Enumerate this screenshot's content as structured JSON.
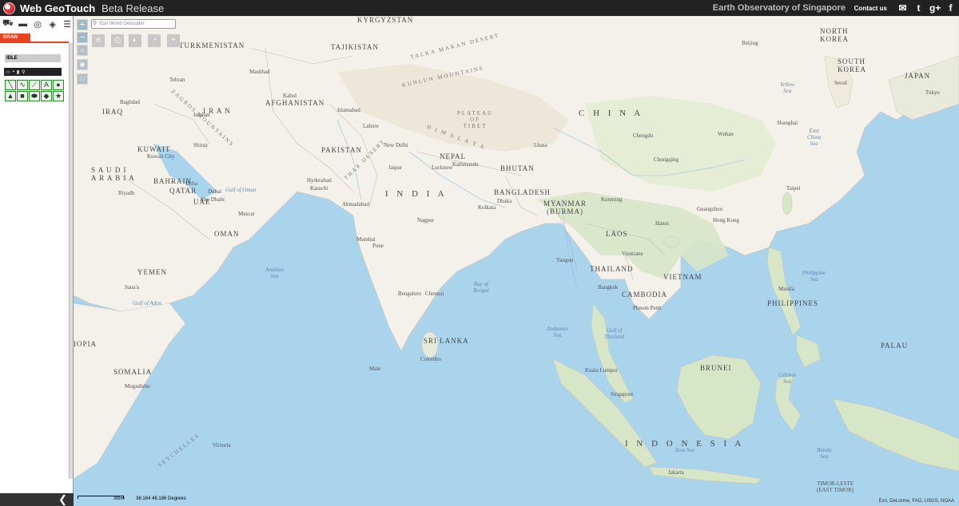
{
  "header": {
    "app_title": "Web GeoTouch",
    "app_subtitle": "Beta Release",
    "organization": "Earth Observatory of Singapore",
    "contact_label": "Contact us",
    "social_icons": [
      "mail-icon",
      "twitter-icon",
      "google-plus-icon",
      "facebook-icon"
    ]
  },
  "panel": {
    "toolbar_icons": [
      "car-icon",
      "ruler-icon",
      "globe-icon",
      "layers-icon",
      "list-icon"
    ],
    "draw_tab": "DRAW",
    "status": "IDLE",
    "file_icons": [
      "open-folder-icon",
      "save-icon",
      "trash-icon",
      "search-icon"
    ],
    "shape_tools": [
      "polyline-tool",
      "freehand-line-tool",
      "multi-line-tool",
      "text-tool",
      "point-tool",
      "triangle-tool",
      "rectangle-tool",
      "ellipse-tool",
      "freehand-polygon-tool",
      "star-tool"
    ],
    "collapse_icon": "chevron-left-icon"
  },
  "map": {
    "search_placeholder": "Esri World Geocoder",
    "scale_label": "300mi",
    "coordinates": "38.164  46.186 Degrees",
    "attribution": "Esri, DeLorme, FAO, USGS, NOAA",
    "labels": {
      "china": "C H I N A",
      "india": "I N D I A",
      "pakistan": "PAKISTAN",
      "afghanistan": "AFGHANISTAN",
      "iran": "I R A N",
      "turkmenistan": "TURKMENISTAN",
      "tajikistan": "TAJIKISTAN",
      "kyrgyzstan": "KYRGYZSTAN",
      "saudi_arabia": "S A U D I\nA R A B I A",
      "oman": "OMAN",
      "yemen": "YEMEN",
      "uae": "UAE",
      "qatar": "QATAR",
      "bahrain": "BAHRAIN",
      "kuwait": "KUWAIT",
      "iraq": "IRAQ",
      "nepal": "NEPAL",
      "bhutan": "BHUTAN",
      "bangladesh": "BANGLADESH",
      "myanmar": "MYANMAR\n(BURMA)",
      "laos": "LAOS",
      "thailand": "THAILAND",
      "vietnam": "VIETNAM",
      "cambodia": "CAMBODIA",
      "philippines": "PHILIPPINES",
      "north_korea": "NORTH\nKOREA",
      "south_korea": "SOUTH\nKOREA",
      "japan": "JAPAN",
      "sri_lanka": "SRI LANKA",
      "somalia": "SOMALIA",
      "ethiopia": "IOPIA",
      "seychelles": "SEYCHELLES",
      "brunei": "BRUNEI",
      "indonesia": "I N D O N E S I A",
      "palau": "PALAU",
      "timor": "TIMOR-LESTE\n(EAST TIMOR)",
      "arabian_sea": "Arabian\nSea",
      "bay_of_bengal": "Bay of\nBengal",
      "andaman_sea": "Andaman\nSea",
      "gulf_of_thailand": "Gulf of\nThailand",
      "philippine_sea": "Philippine\nSea",
      "east_china_sea": "East\nChina\nSea",
      "yellow_sea": "Yellow\nSea",
      "celebes_sea": "Celebes\nSea",
      "java_sea": "Java Sea",
      "banda_sea": "Banda\nSea",
      "gulf_of_aden": "Gulf of Aden",
      "gulf_of_oman": "Gulf of Oman",
      "taklimakan": "TALKA MAKAN DESERT",
      "plateau_tibet": "PLATEAU\nOF\nTIBET",
      "zagros": "ZAGROS MOUNTAINS",
      "thar_desert": "THAR DESERT",
      "kunlun": "KUNLUN MOUNTAINS",
      "himalaya": "H I M A L A Y A",
      "cities": [
        "Tehran",
        "Kabul",
        "Islamabad",
        "New Delhi",
        "Kathmandu",
        "Dhaka",
        "Beijing",
        "Shanghai",
        "Seoul",
        "Tokyo",
        "Manila",
        "Bangkok",
        "Hanoi",
        "Singapore",
        "Jakarta",
        "Kuala Lumpur",
        "Mumbai",
        "Chennai",
        "Bengaluru",
        "Kolkata",
        "Karachi",
        "Riyadh",
        "Doha",
        "Muscat",
        "Sana'a",
        "Colombo",
        "Yangon",
        "Taipei",
        "Hong Kong",
        "Chengdu",
        "Lhasa",
        "Mogadishu",
        "Victoria",
        "Male",
        "Phnom Penh",
        "Vientiane",
        "Wuhan",
        "Kunming",
        "Guangzhou",
        "Chongqing",
        "Lahore",
        "Hyderabad",
        "Ahmadabad",
        "Pune",
        "Nagpur",
        "Jaipur",
        "Lucknow",
        "Dubai",
        "Abu Dhabi",
        "Mashhad",
        "Shiraz",
        "Isfahan",
        "Baghdad",
        "Kuwait City"
      ]
    }
  }
}
